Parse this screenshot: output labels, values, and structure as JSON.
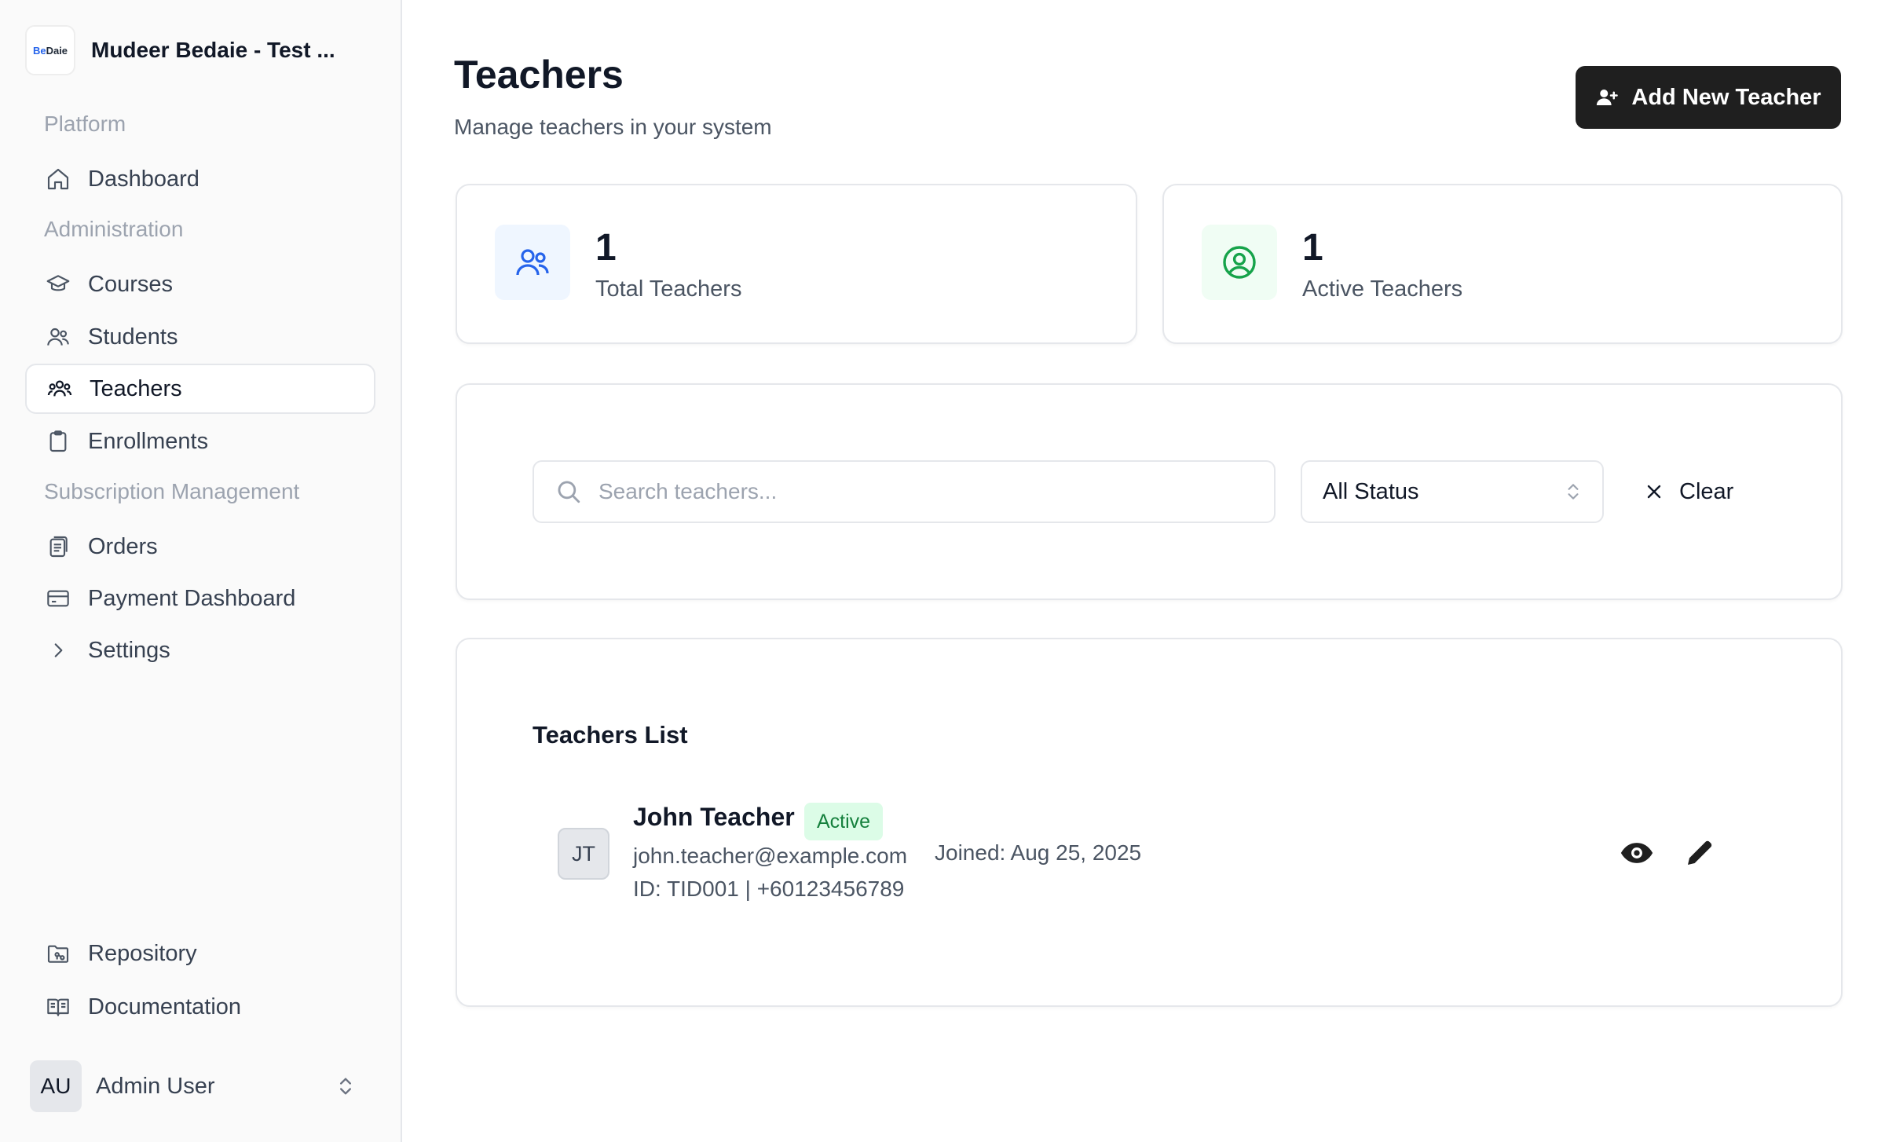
{
  "app": {
    "name": "Mudeer Bedaie - Test ...",
    "logo_prefix": "Be",
    "logo_suffix": "Daie"
  },
  "sidebar": {
    "sections": {
      "platform": "Platform",
      "administration": "Administration",
      "subscription": "Subscription Management"
    },
    "items": {
      "dashboard": "Dashboard",
      "courses": "Courses",
      "students": "Students",
      "teachers": "Teachers",
      "enrollments": "Enrollments",
      "orders": "Orders",
      "payment_dashboard": "Payment Dashboard",
      "settings": "Settings",
      "repository": "Repository",
      "documentation": "Documentation"
    },
    "active_item": "teachers",
    "user": {
      "initials": "AU",
      "name": "Admin User"
    }
  },
  "header": {
    "title": "Teachers",
    "subtitle": "Manage teachers in your system",
    "add_button": "Add New Teacher"
  },
  "stats": {
    "total": {
      "value": "1",
      "label": "Total Teachers"
    },
    "active": {
      "value": "1",
      "label": "Active Teachers"
    }
  },
  "filters": {
    "search_placeholder": "Search teachers...",
    "search_value": "",
    "status_selected": "All Status",
    "clear_label": "Clear"
  },
  "list": {
    "title": "Teachers List",
    "rows": [
      {
        "initials": "JT",
        "name": "John Teacher",
        "status": "Active",
        "email": "john.teacher@example.com",
        "id_phone": "ID: TID001 | +60123456789",
        "joined": "Joined: Aug 25, 2025"
      }
    ]
  },
  "colors": {
    "primary_button": "#1f1f1f",
    "total_icon": "#2563eb",
    "total_icon_bg": "#eff6ff",
    "active_icon": "#16a34a",
    "active_icon_bg": "#f0fdf4",
    "badge_bg": "#dcfce7",
    "badge_text": "#15803d"
  }
}
